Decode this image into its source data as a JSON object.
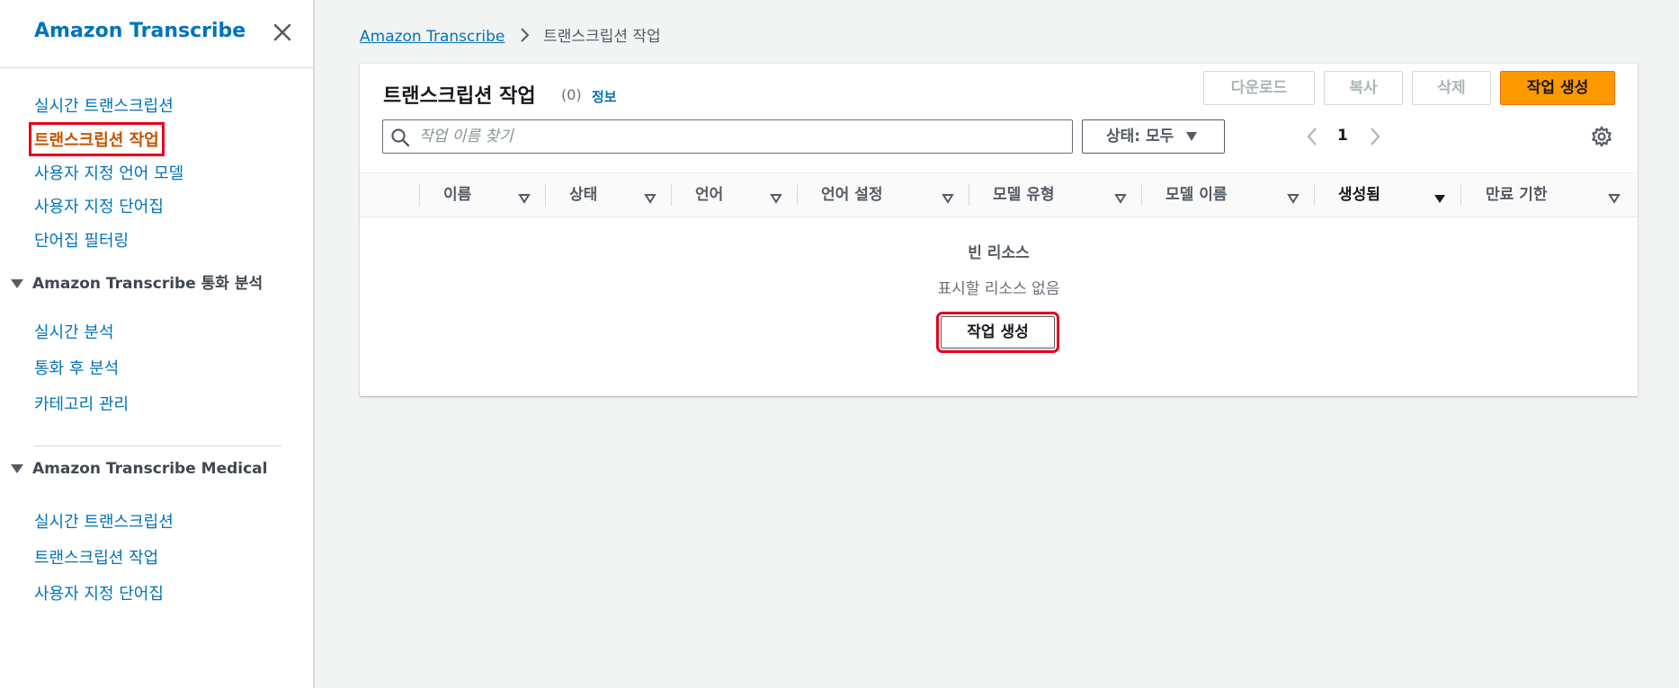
{
  "sidebar": {
    "title": "Amazon Transcribe",
    "links": [
      {
        "label": "실시간 트랜스크립션"
      },
      {
        "label": "트랜스크립션 작업"
      },
      {
        "label": "사용자 지정 언어 모델"
      },
      {
        "label": "사용자 지정 단어집"
      },
      {
        "label": "단어집 필터링"
      }
    ],
    "call_analytics": {
      "title": "Amazon Transcribe 통화 분석",
      "links": [
        {
          "label": "실시간 분석"
        },
        {
          "label": "통화 후 분석"
        },
        {
          "label": "카테고리 관리"
        }
      ]
    },
    "medical": {
      "title": "Amazon Transcribe Medical",
      "links": [
        {
          "label": "실시간 트랜스크립션"
        },
        {
          "label": "트랜스크립션 작업"
        },
        {
          "label": "사용자 지정 단어집"
        }
      ]
    }
  },
  "breadcrumb": {
    "root": "Amazon Transcribe",
    "current": "트랜스크립션 작업"
  },
  "panel": {
    "title": "트랜스크립션 작업",
    "count": "(0)",
    "info": "정보",
    "buttons": {
      "download": "다운로드",
      "copy": "복사",
      "delete": "삭제",
      "create": "작업 생성"
    },
    "search": {
      "placeholder": "작업 이름 찾기",
      "value": ""
    },
    "filter": {
      "label": "상태: 모두"
    },
    "pagination": {
      "current": "1"
    },
    "columns": [
      "이름",
      "상태",
      "언어",
      "언어 설정",
      "모델 유형",
      "모델 이름",
      "생성됨",
      "만료 기한"
    ],
    "empty": {
      "title": "빈 리소스",
      "description": "표시할 리소스 없음",
      "button": "작업 생성"
    }
  },
  "colors": {
    "link": "#0073bb",
    "active": "#c45500",
    "primary": "#ff9900",
    "highlight": "#e3001b"
  }
}
